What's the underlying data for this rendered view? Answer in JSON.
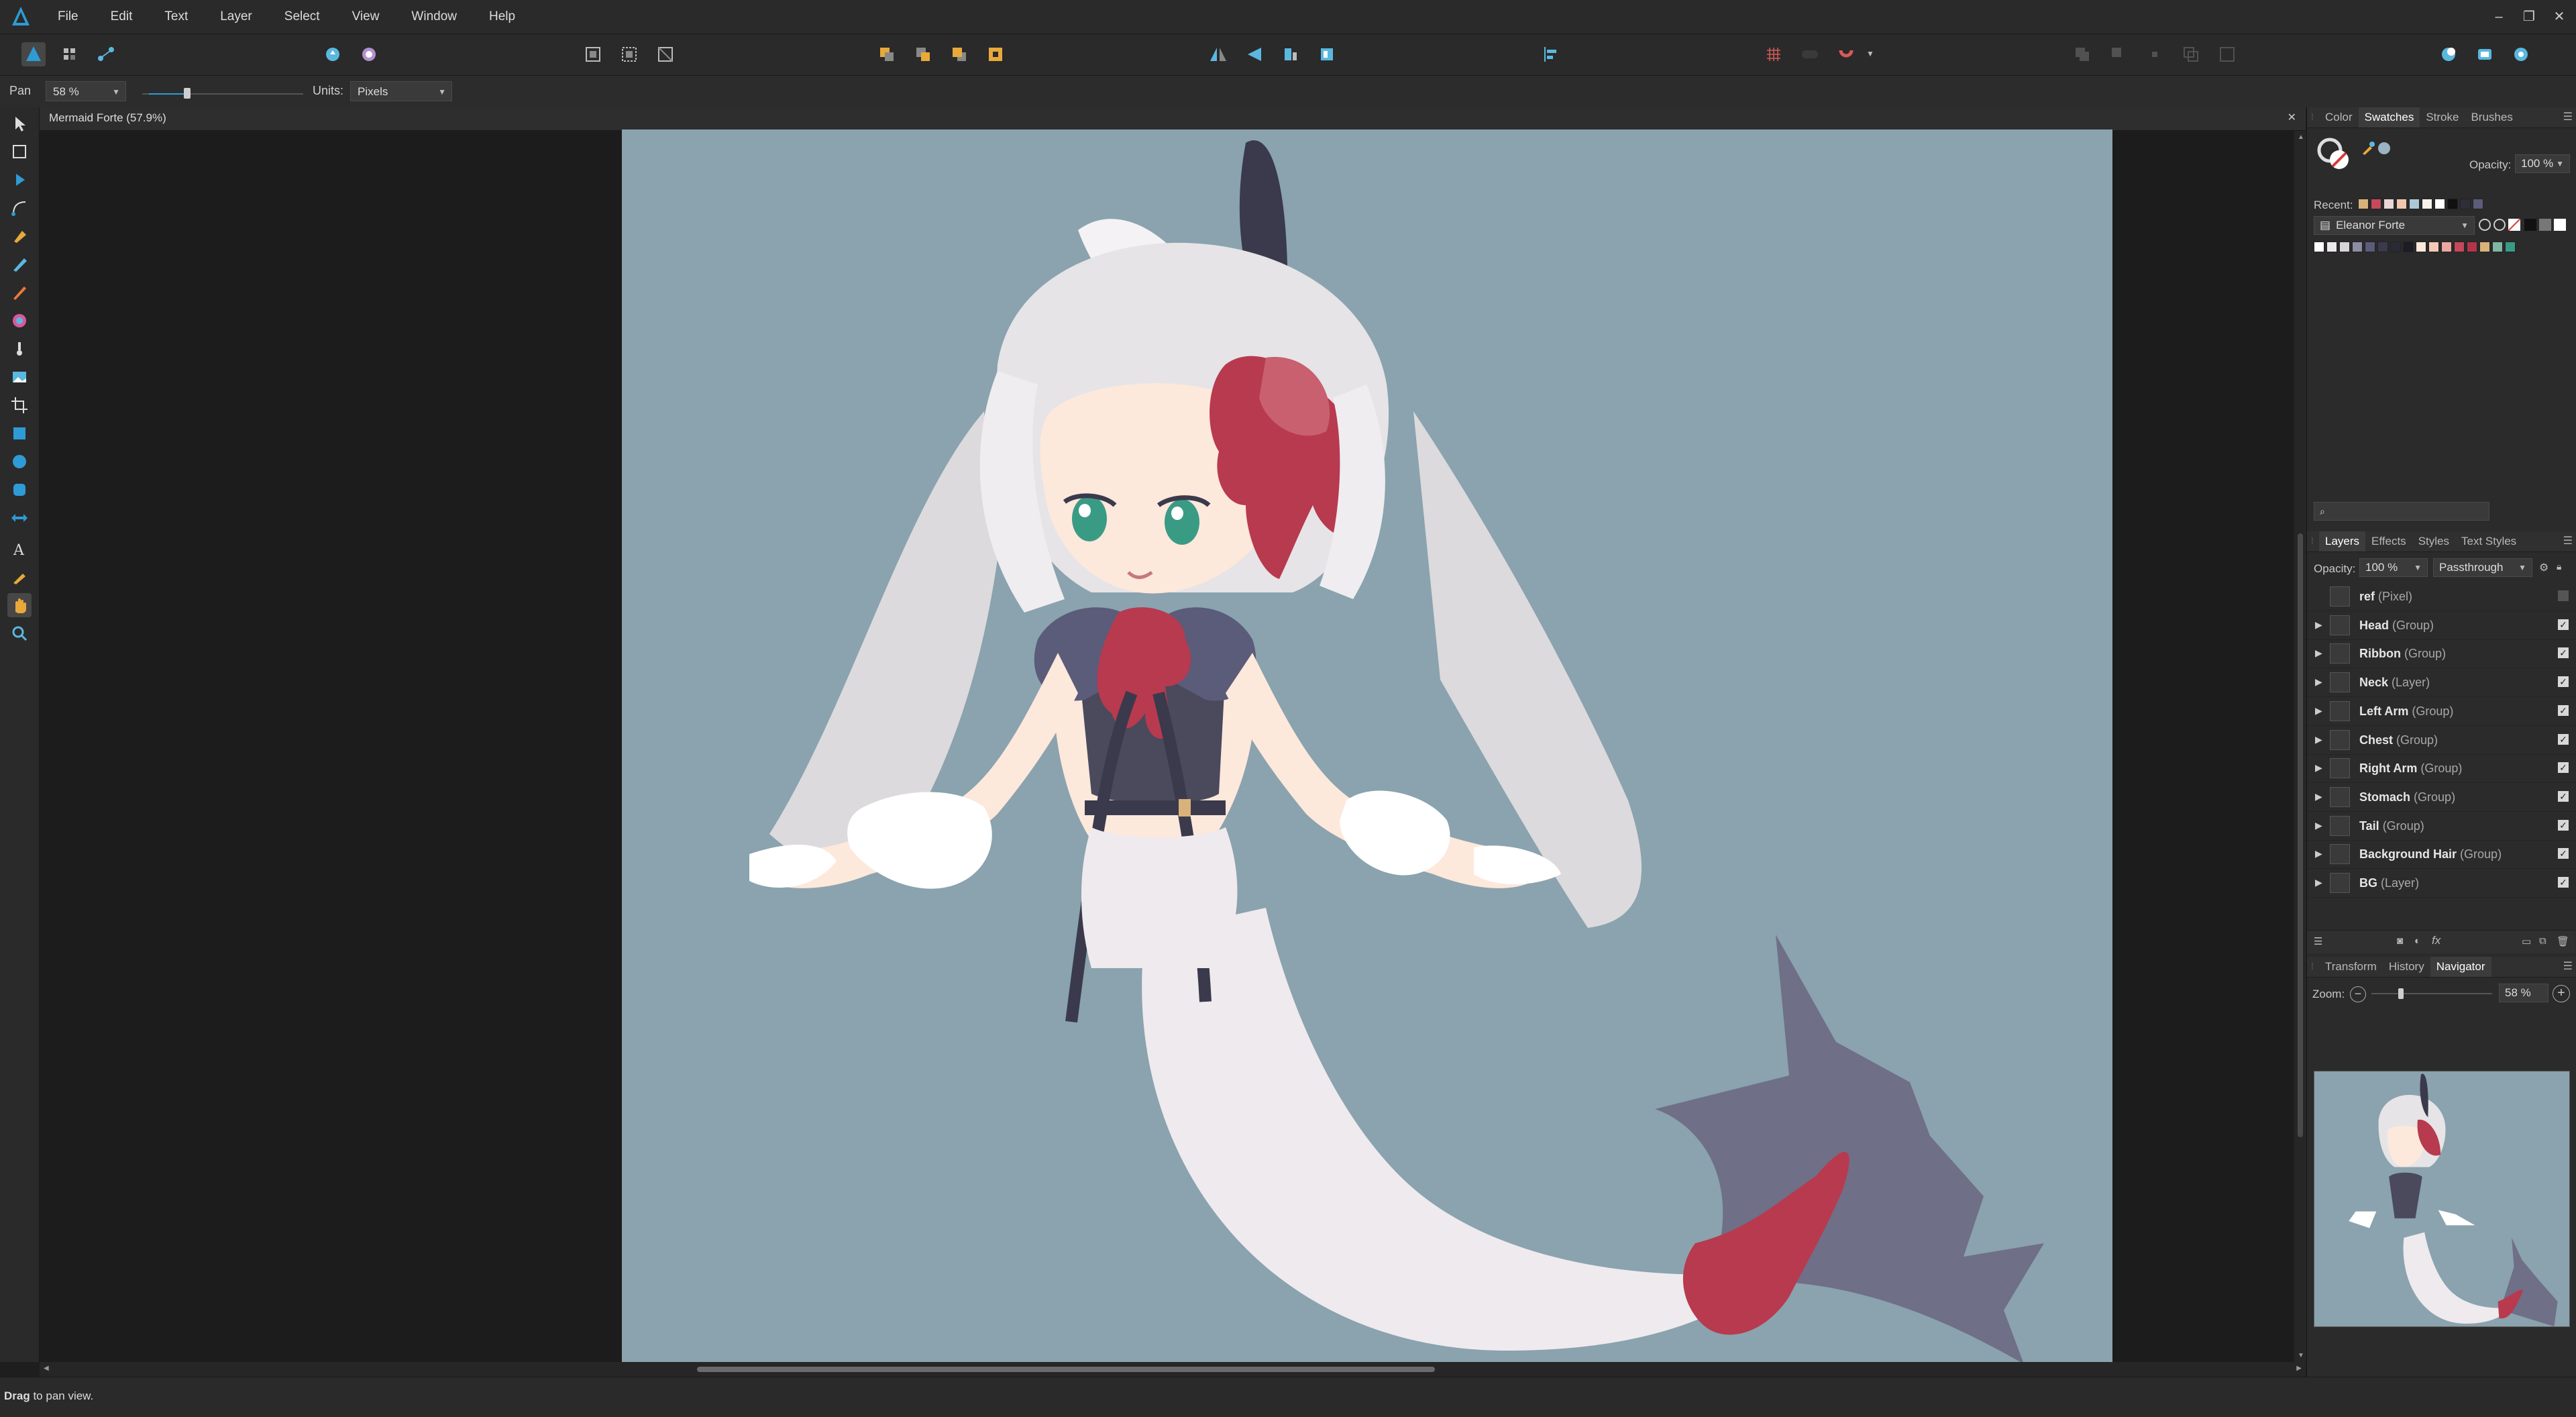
{
  "app": {
    "logo_icon": "affinity-designer-logo-icon"
  },
  "menu": [
    "File",
    "Edit",
    "Text",
    "Layer",
    "Select",
    "View",
    "Window",
    "Help"
  ],
  "window_controls": {
    "minimize": "–",
    "restore": "❐",
    "close": "✕"
  },
  "context_bar": {
    "tool_name": "Pan",
    "zoom_value": "58 %",
    "units_label": "Units:",
    "units_value": "Pixels"
  },
  "document": {
    "tab_title": "Mermaid Forte (57.9%)",
    "close_glyph": "✕"
  },
  "status": {
    "bold": "Drag",
    "rest": " to pan view."
  },
  "colors": {
    "accent": "#2e9bd6",
    "canvas_bg": "#8aa3ae",
    "red_accent": "#b83a4f",
    "fin": "#6f6f87"
  },
  "swatches_panel": {
    "tabs": [
      "Color",
      "Swatches",
      "Stroke",
      "Brushes"
    ],
    "active_tab": "Swatches",
    "opacity_label": "Opacity:",
    "opacity_value": "100 %",
    "recent_label": "Recent:",
    "palette_name": "Eleanor Forte",
    "recent_colors": [
      "#d8b27a",
      "#c4495a",
      "#e9d6d6",
      "#f0c8b0",
      "#aec7d6",
      "#f7f2ee",
      "#ffffff",
      "#111111",
      "#2e2e3a",
      "#5b5b7a"
    ],
    "palette_colors": [
      "#ffffff",
      "#ece9ec",
      "#d8d4da",
      "#8c8ca2",
      "#5b5b7a",
      "#3a3a4c",
      "#2a2a36",
      "#1c1c24",
      "#fde8dc",
      "#f6c9b6",
      "#e8a8a0",
      "#c4495a",
      "#b3344a",
      "#d8b27a",
      "#7fb7a5",
      "#3a9b85"
    ]
  },
  "layers_panel": {
    "tabs": [
      "Layers",
      "Effects",
      "Styles",
      "Text Styles"
    ],
    "active_tab": "Layers",
    "opacity_label": "Opacity:",
    "opacity_value": "100 %",
    "blend_mode": "Passthrough",
    "layers": [
      {
        "name": "ref",
        "type": "(Pixel)",
        "expandable": false,
        "visible": false
      },
      {
        "name": "Head",
        "type": "(Group)",
        "expandable": true,
        "visible": true
      },
      {
        "name": "Ribbon",
        "type": "(Group)",
        "expandable": true,
        "visible": true
      },
      {
        "name": "Neck",
        "type": "(Layer)",
        "expandable": true,
        "visible": true
      },
      {
        "name": "Left Arm",
        "type": "(Group)",
        "expandable": true,
        "visible": true
      },
      {
        "name": "Chest",
        "type": "(Group)",
        "expandable": true,
        "visible": true
      },
      {
        "name": "Right Arm",
        "type": "(Group)",
        "expandable": true,
        "visible": true
      },
      {
        "name": "Stomach",
        "type": "(Group)",
        "expandable": true,
        "visible": true
      },
      {
        "name": "Tail",
        "type": "(Group)",
        "expandable": true,
        "visible": true
      },
      {
        "name": "Background Hair",
        "type": "(Group)",
        "expandable": true,
        "visible": true
      },
      {
        "name": "BG",
        "type": "(Layer)",
        "expandable": true,
        "visible": true
      }
    ],
    "fx_label": "fx"
  },
  "navigator_panel": {
    "tabs": [
      "Transform",
      "History",
      "Navigator"
    ],
    "active_tab": "Navigator",
    "zoom_label": "Zoom:",
    "zoom_value": "58 %"
  }
}
